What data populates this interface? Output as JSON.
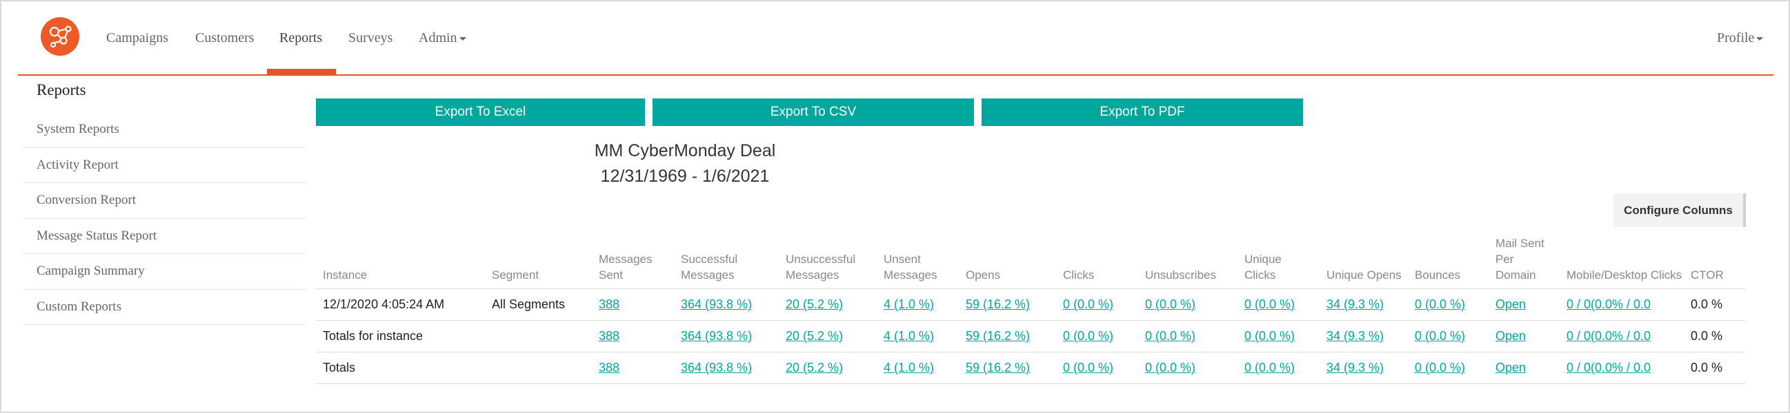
{
  "nav": {
    "items": [
      {
        "label": "Campaigns"
      },
      {
        "label": "Customers"
      },
      {
        "label": "Reports"
      },
      {
        "label": "Surveys"
      },
      {
        "label": "Admin"
      }
    ],
    "profile": "Profile",
    "active": "Reports",
    "accent_color": "#e8542a"
  },
  "sidebar": {
    "title": "Reports",
    "items": [
      {
        "label": "System Reports"
      },
      {
        "label": "Activity Report"
      },
      {
        "label": "Conversion Report"
      },
      {
        "label": "Message Status Report"
      },
      {
        "label": "Campaign Summary"
      },
      {
        "label": "Custom Reports"
      }
    ]
  },
  "export": {
    "excel": "Export To Excel",
    "csv": "Export To CSV",
    "pdf": "Export To PDF",
    "button_color": "#00a79d"
  },
  "report": {
    "title": "MM CyberMonday Deal",
    "date_range": "12/31/1969 - 1/6/2021",
    "configure_columns": "Configure Columns"
  },
  "table": {
    "headers": [
      [
        "Instance"
      ],
      [
        "Segment"
      ],
      [
        "Messages",
        "Sent"
      ],
      [
        "Successful",
        "Messages"
      ],
      [
        "Unsuccessful",
        "Messages"
      ],
      [
        "Unsent",
        "Messages"
      ],
      [
        "Opens"
      ],
      [
        "Clicks"
      ],
      [
        "Unsubscribes"
      ],
      [
        "Unique",
        "Clicks"
      ],
      [
        "Unique Opens"
      ],
      [
        "Bounces"
      ],
      [
        "Mail Sent",
        "Per",
        "Domain"
      ],
      [
        "Mobile/Desktop Clicks"
      ],
      [
        "CTOR"
      ]
    ],
    "rows": [
      [
        "12/1/2020 4:05:24 AM",
        "All Segments",
        "388",
        "364 (93.8 %)",
        "20 (5.2 %)",
        "4 (1.0 %)",
        "59 (16.2 %)",
        "0 (0.0 %)",
        "0 (0.0 %)",
        "0 (0.0 %)",
        "34 (9.3 %)",
        "0 (0.0 %)",
        "Open",
        "0 / 0(0.0% / 0.0",
        "0.0 %"
      ],
      [
        "Totals for instance",
        "",
        "388",
        "364 (93.8 %)",
        "20 (5.2 %)",
        "4 (1.0 %)",
        "59 (16.2 %)",
        "0 (0.0 %)",
        "0 (0.0 %)",
        "0 (0.0 %)",
        "34 (9.3 %)",
        "0 (0.0 %)",
        "Open",
        "0 / 0(0.0% / 0.0",
        "0.0 %"
      ],
      [
        "Totals",
        "",
        "388",
        "364 (93.8 %)",
        "20 (5.2 %)",
        "4 (1.0 %)",
        "59 (16.2 %)",
        "0 (0.0 %)",
        "0 (0.0 %)",
        "0 (0.0 %)",
        "34 (9.3 %)",
        "0 (0.0 %)",
        "Open",
        "0 / 0(0.0% / 0.0",
        "0.0 %"
      ]
    ]
  }
}
